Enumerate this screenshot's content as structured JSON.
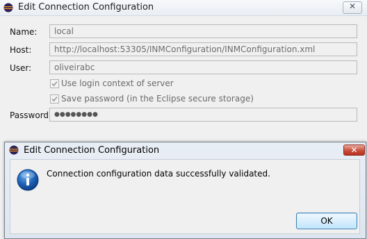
{
  "back_window": {
    "title": "Edit Connection Configuration",
    "close_glyph": "✕",
    "fields": {
      "name": {
        "label": "Name:",
        "value": "local"
      },
      "host": {
        "label": "Host:",
        "value": "http://localhost:53305/INMConfiguration/INMConfiguration.xml"
      },
      "user": {
        "label": "User:",
        "value": "oliveirabc"
      },
      "password": {
        "label": "Password:",
        "value": "●●●●●●●●"
      }
    },
    "checkboxes": {
      "login_context": {
        "label": "Use login context of server",
        "checked": true
      },
      "save_password": {
        "label": "Save password (in the Eclipse secure storage)",
        "checked": true
      }
    },
    "title_icon": "eclipse-icon"
  },
  "message_dialog": {
    "title": "Edit Connection Configuration",
    "close_glyph": "✕",
    "message": "Connection configuration data successfully validated.",
    "icon": "info-icon",
    "ok_label": "OK"
  },
  "colors": {
    "eclipse_purple": "#2c2255",
    "eclipse_orange": "#f7941e",
    "info_blue": "#1e63b8",
    "close_red": "#c94f3c"
  }
}
